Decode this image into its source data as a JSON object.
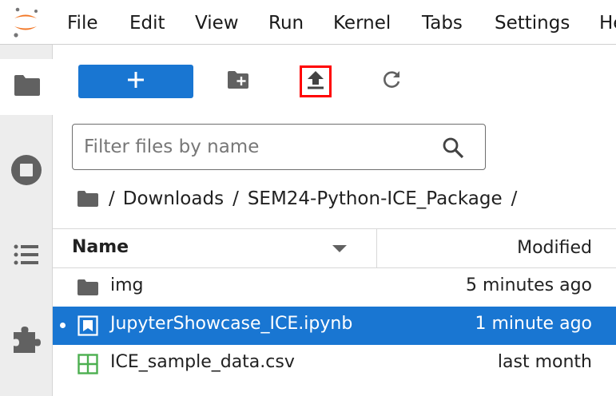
{
  "menubar": {
    "items": [
      "File",
      "Edit",
      "View",
      "Run",
      "Kernel",
      "Tabs",
      "Settings",
      "He"
    ]
  },
  "sidebar": {
    "tabs": [
      {
        "icon": "folder-icon",
        "active": true
      },
      {
        "icon": "stop-circle-icon",
        "active": false
      },
      {
        "icon": "list-icon",
        "active": false
      },
      {
        "icon": "puzzle-icon",
        "active": false
      }
    ]
  },
  "toolbar": {
    "new_launcher_icon": "plus-icon",
    "new_folder_icon": "new-folder-icon",
    "upload_icon": "upload-icon",
    "refresh_icon": "refresh-icon",
    "highlighted": "upload-button"
  },
  "filter": {
    "placeholder": "Filter files by name",
    "value": ""
  },
  "breadcrumbs": {
    "separator": "/",
    "segments": [
      "Downloads",
      "SEM24-Python-ICE_Package"
    ],
    "trailing": "/"
  },
  "filelist": {
    "columns": {
      "name": "Name",
      "modified": "Modified"
    },
    "rows": [
      {
        "name": "img",
        "modified": "5 minutes ago",
        "type": "folder",
        "selected": false
      },
      {
        "name": "JupyterShowcase_ICE.ipynb",
        "modified": "1 minute ago",
        "type": "notebook",
        "selected": true
      },
      {
        "name": "ICE_sample_data.csv",
        "modified": "last month",
        "type": "csv",
        "selected": false
      }
    ]
  },
  "colors": {
    "accent": "#1976d2",
    "highlight_outline": "#ff0000",
    "csv_icon": "#4caf50",
    "jupyter_orange": "#f37726"
  }
}
